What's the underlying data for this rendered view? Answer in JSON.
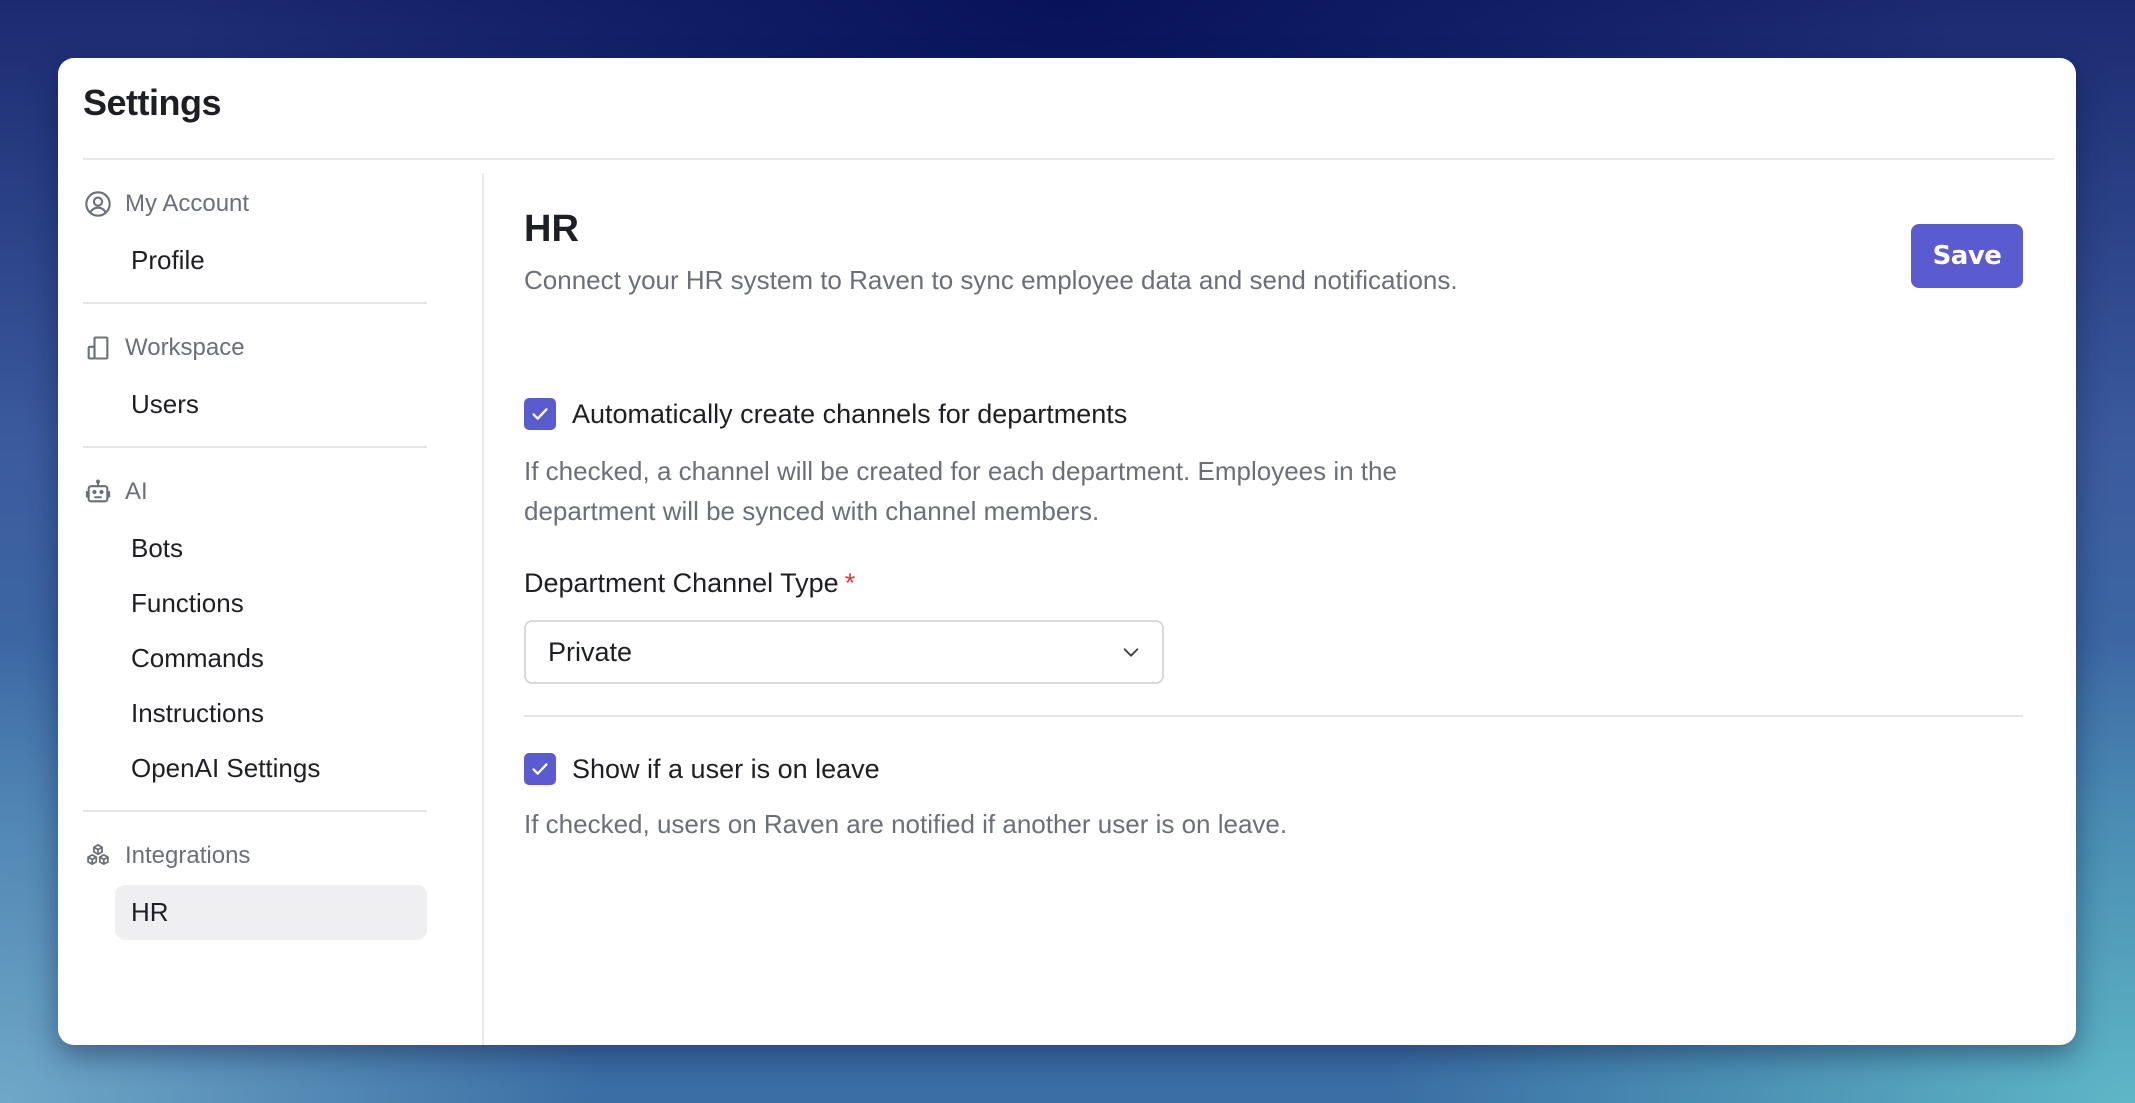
{
  "window": {
    "title": "Settings"
  },
  "sidebar": {
    "groups": [
      {
        "label": "My Account",
        "icon": "user-circle-icon",
        "items": [
          {
            "label": "Profile",
            "active": false
          }
        ]
      },
      {
        "label": "Workspace",
        "icon": "building-icon",
        "items": [
          {
            "label": "Users",
            "active": false
          }
        ]
      },
      {
        "label": "AI",
        "icon": "robot-icon",
        "items": [
          {
            "label": "Bots",
            "active": false
          },
          {
            "label": "Functions",
            "active": false
          },
          {
            "label": "Commands",
            "active": false
          },
          {
            "label": "Instructions",
            "active": false
          },
          {
            "label": "OpenAI Settings",
            "active": false
          }
        ]
      },
      {
        "label": "Integrations",
        "icon": "cubes-icon",
        "items": [
          {
            "label": "HR",
            "active": true
          }
        ]
      }
    ]
  },
  "main": {
    "title": "HR",
    "description": "Connect your HR system to Raven to sync employee data and send notifications.",
    "save_label": "Save",
    "auto_channels": {
      "label": "Automatically create channels for departments",
      "checked": true,
      "help": "If checked, a channel will be created for each department. Employees in the department will be synced with channel members."
    },
    "channel_type": {
      "label": "Department Channel Type",
      "required_mark": "*",
      "value": "Private"
    },
    "show_leave": {
      "label": "Show if a user is on leave",
      "checked": true,
      "help": "If checked, users on Raven are notified if another user is on leave."
    }
  },
  "colors": {
    "accent": "#5b5bd0",
    "required": "#d13b3b",
    "muted_text": "#6b6f78",
    "text": "#1d1f24",
    "active_item_bg": "#efeff1"
  }
}
